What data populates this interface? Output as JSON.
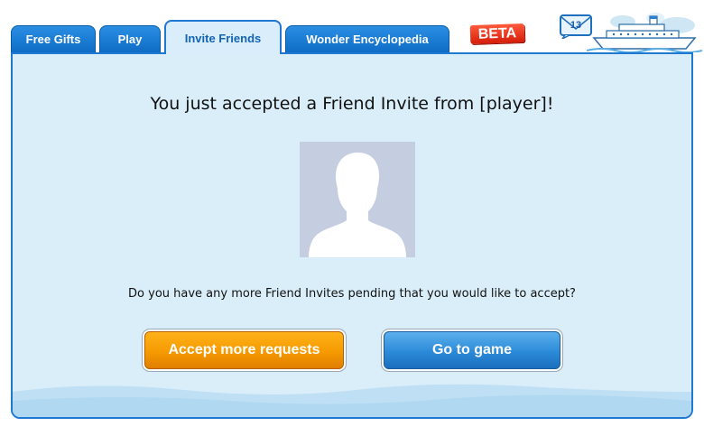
{
  "tabs": [
    {
      "label": "Free Gifts"
    },
    {
      "label": "Play"
    },
    {
      "label": "Invite Friends"
    },
    {
      "label": "Wonder Encyclopedia"
    }
  ],
  "beta_badge": "BETA",
  "mail": {
    "count": "13",
    "icon": "envelope-icon"
  },
  "ship_icon": "cruise-ship-icon",
  "colors": {
    "tab_blue": "#1a7ad4",
    "panel_bg": "#daeef9",
    "accept_orange": "#f59a00",
    "go_blue": "#2b8ad8",
    "beta_red": "#e0301a"
  },
  "main": {
    "headline": "You just accepted a Friend Invite from [player]!",
    "question": "Do you have any more Friend Invites pending that you would like to accept?",
    "accept_button": "Accept more requests",
    "go_button": "Go to game"
  }
}
